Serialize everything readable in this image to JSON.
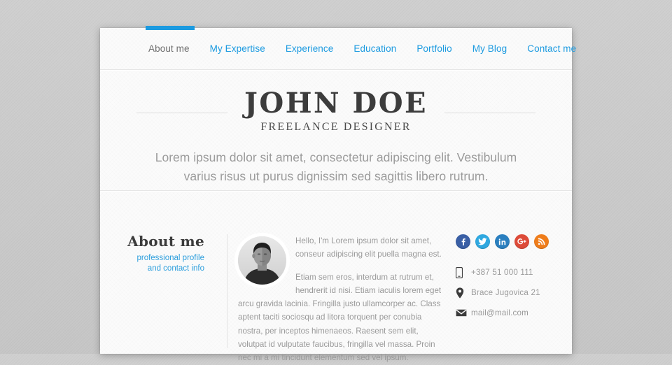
{
  "nav": {
    "items": [
      {
        "label": "About me",
        "active": true
      },
      {
        "label": "My Expertise",
        "active": false
      },
      {
        "label": "Experience",
        "active": false
      },
      {
        "label": "Education",
        "active": false
      },
      {
        "label": "Portfolio",
        "active": false
      },
      {
        "label": "My Blog",
        "active": false
      },
      {
        "label": "Contact me",
        "active": false
      }
    ],
    "accent_color": "#1b9ae0",
    "active_color": "#6e6e6e"
  },
  "header": {
    "name": "JOHN DOE",
    "subtitle": "FREELANCE DESIGNER",
    "tagline": "Lorem ipsum dolor sit amet, consectetur adipiscing elit. Vestibulum varius risus ut purus dignissim sed sagittis libero rutrum."
  },
  "about": {
    "heading": "About me",
    "sub_line1": "professional profile",
    "sub_line2": "and contact info",
    "sub_color": "#2e9fdd",
    "avatar_alt": "portrait-photo",
    "paragraphs": [
      "Hello, I'm Lorem ipsum dolor sit amet, conseur adipiscing elit puella magna est.",
      "Etiam sem eros, interdum at rutrum et, hendrerit id nisi. Etiam iaculis lorem eget arcu gravida lacinia. Fringilla justo ullamcorper ac. Class aptent taciti sociosqu ad litora torquent per conubia nostra, per inceptos himenaeos. Raesent sem elit, volutpat id vulputate faucibus, fringilla vel massa. Proin nec mi a mi tincidunt elementum sed vel ipsum."
    ]
  },
  "social": [
    {
      "name": "facebook",
      "color": "#3a5fa5",
      "glyph": "f"
    },
    {
      "name": "twitter",
      "color": "#2fa8e0",
      "glyph": "t"
    },
    {
      "name": "linkedin",
      "color": "#2a7fbf",
      "glyph": "in"
    },
    {
      "name": "googleplus",
      "color": "#dd4b39",
      "glyph": "g+"
    },
    {
      "name": "rss",
      "color": "#ef7d1b",
      "glyph": "rss"
    }
  ],
  "contact": [
    {
      "icon": "phone",
      "value": "+387 51 000 111"
    },
    {
      "icon": "location",
      "value": "Brace Jugovica 21"
    },
    {
      "icon": "mail",
      "value": "mail@mail.com"
    }
  ]
}
